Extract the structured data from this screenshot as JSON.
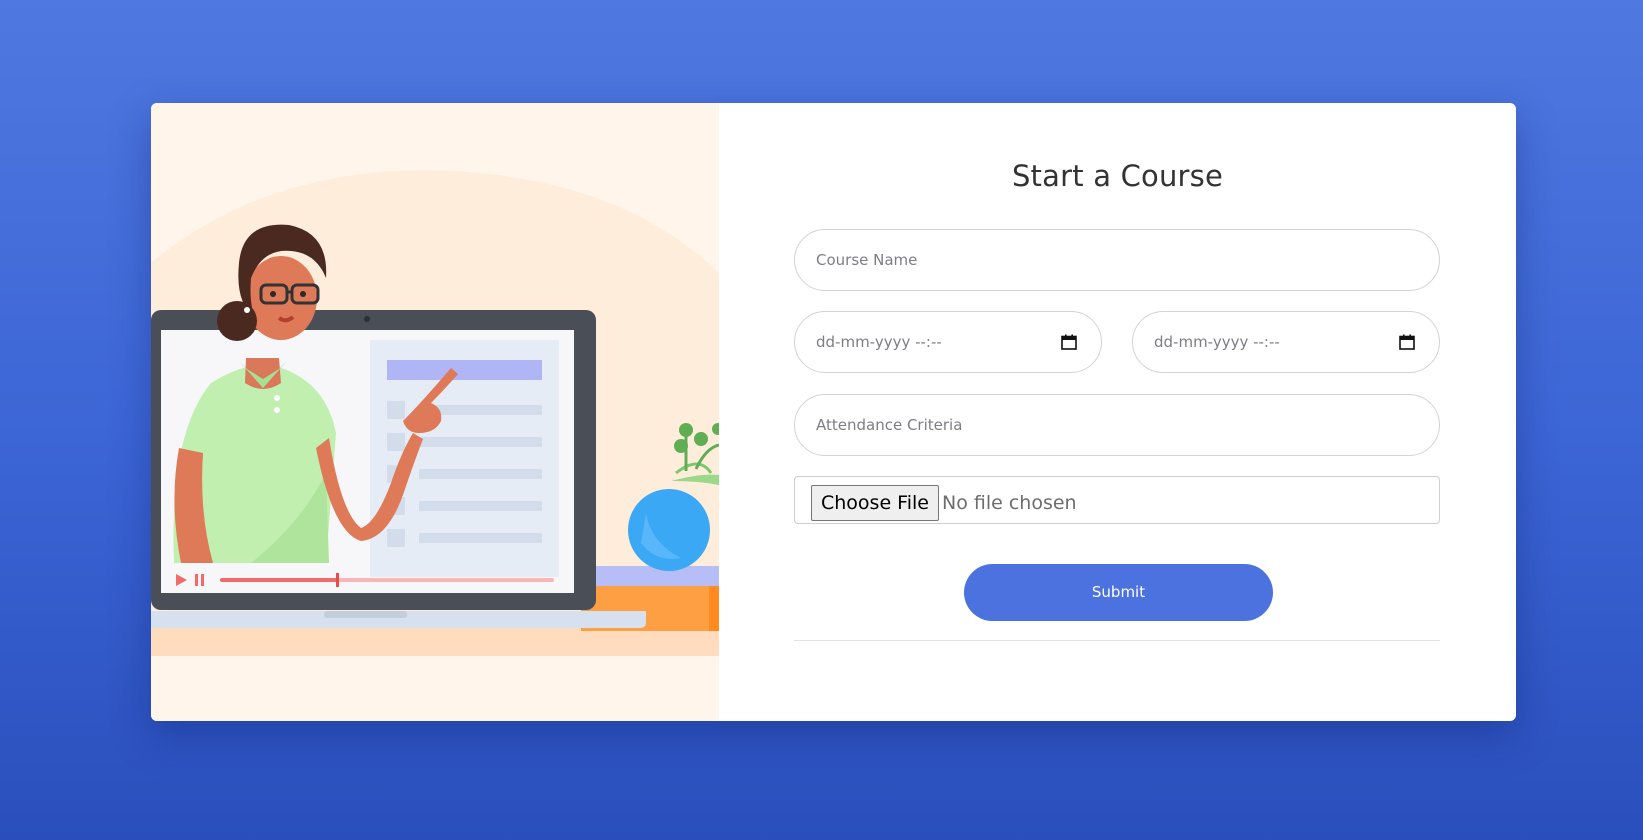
{
  "form": {
    "title": "Start a Course",
    "course_name_placeholder": "Course Name",
    "start_datetime_placeholder": "dd-mm-yyyy --:--",
    "end_datetime_placeholder": "dd-mm-yyyy --:--",
    "attendance_placeholder": "Attendance Criteria",
    "file_button_label": "Choose File",
    "file_status": "No file chosen",
    "submit_label": "Submit"
  },
  "icons": {
    "calendar": "calendar-icon",
    "play": "play-icon",
    "pause": "pause-icon"
  },
  "colors": {
    "background": "#3d66d6",
    "accent": "#4b72de",
    "card": "#ffffff",
    "illustration_bg": "#fff5ea"
  },
  "illustration": {
    "video_progress": 0.35
  }
}
